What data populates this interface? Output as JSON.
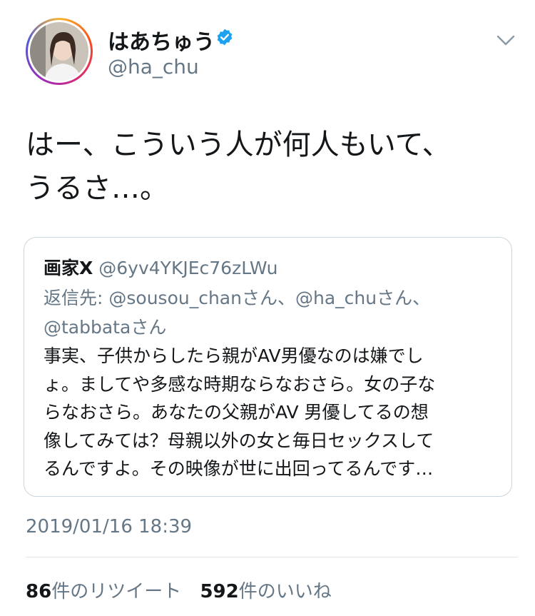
{
  "author": {
    "display_name": "はあちゅう",
    "handle": "@ha_chu",
    "verified_icon": "verified-badge-icon",
    "avatar": "profile-photo"
  },
  "tweet": {
    "text_line1": "はー、こういう人が何人もいて、",
    "text_line2": "うるさ…。",
    "timestamp": "2019/01/16 18:39"
  },
  "quoted_tweet": {
    "name": "画家X",
    "handle": "@6yv4YKJEc76zLWu",
    "reply_prefix": "返信先: ",
    "mention1": "@sousou_chan",
    "mention1_suffix": "さん、",
    "mention2": "@ha_chu",
    "mention2_suffix": "さん、",
    "mention3": "@tabbata",
    "mention3_suffix": "さん",
    "body_lines": [
      "事実、子供からしたら親がAV男優なのは嫌でし",
      "ょ。ましてや多感な時期ならなおさら。女の子な",
      "らなおさら。あなたの父親がAV 男優してるの想",
      "像してみては？母親以外の女と毎日セックスして",
      "るんですよ。その映像が世に出回ってるんです…"
    ]
  },
  "stats": {
    "retweets_count": "86",
    "retweets_label": "件のリツイート",
    "likes_count": "592",
    "likes_label": "件のいいね"
  },
  "colors": {
    "text": "#14171a",
    "secondary": "#657786",
    "verified": "#1da1f2",
    "border": "#ccd6dd"
  }
}
